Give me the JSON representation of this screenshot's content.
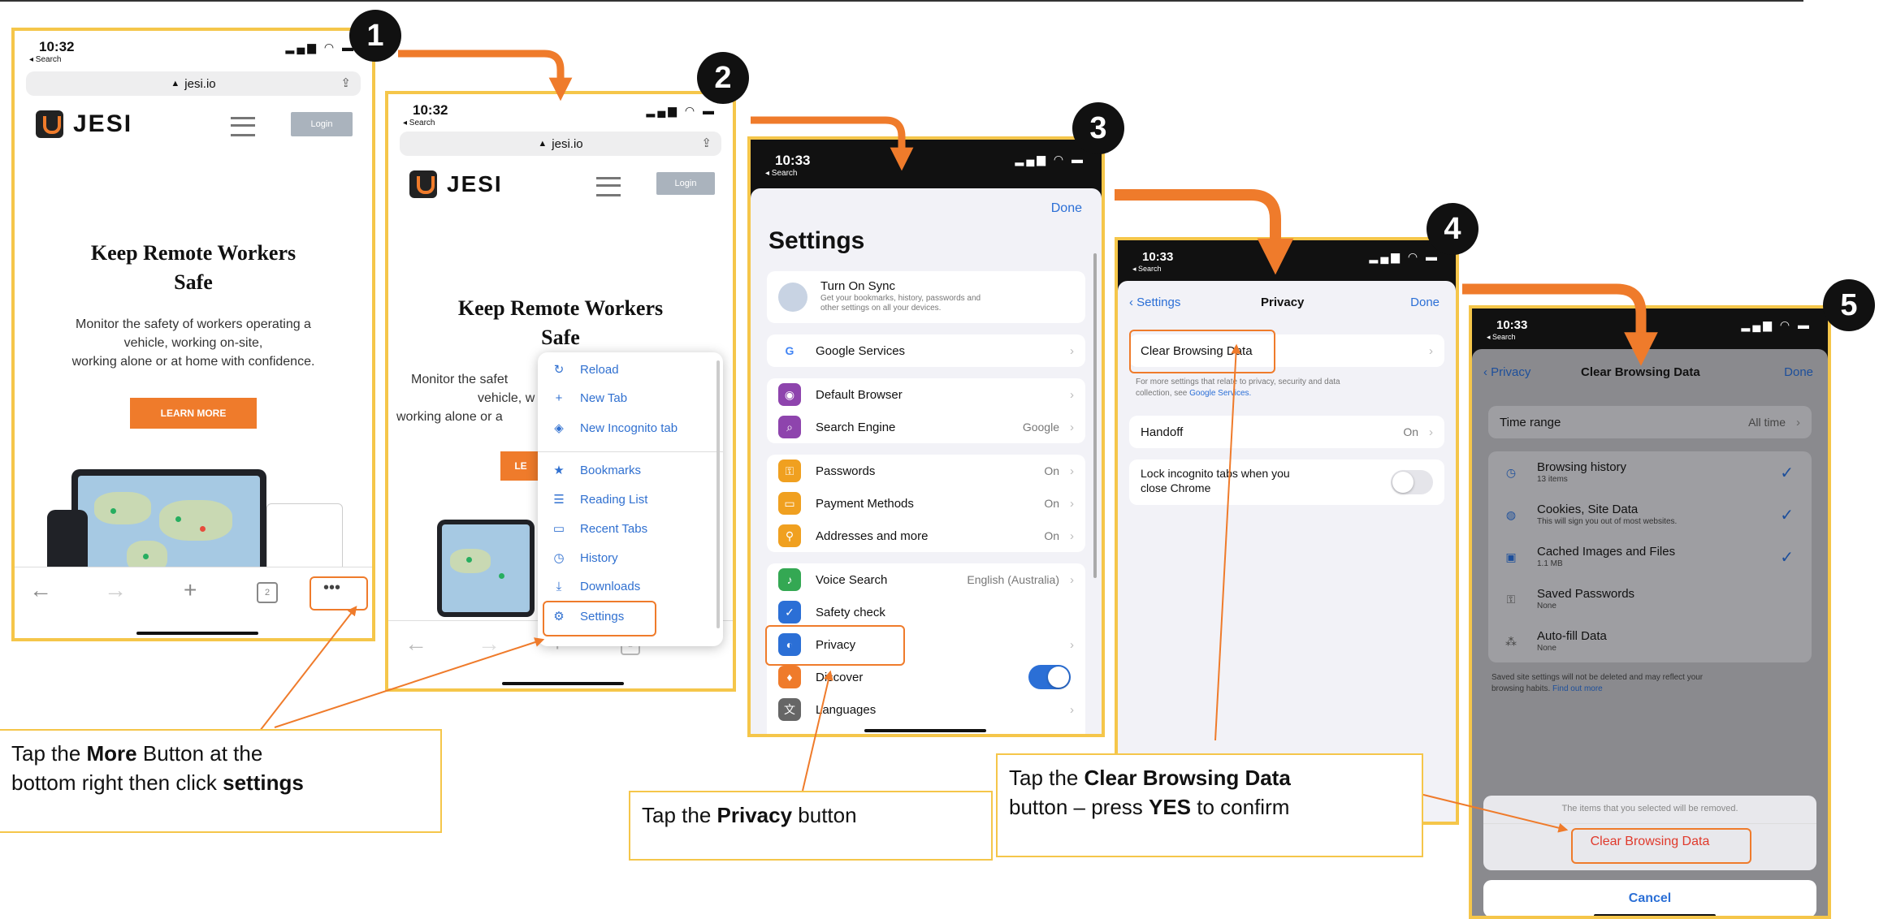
{
  "colors": {
    "accent": "#ef7b2b",
    "frame": "#f5c64a",
    "ios_blue": "#2b6fd6"
  },
  "steps": [
    "1",
    "2",
    "3",
    "4",
    "5"
  ],
  "phone1": {
    "time": "10:32",
    "back": "◂ Search",
    "url": "jesi.io",
    "brand": "JESI",
    "login": "Login",
    "headline_l1": "Keep Remote Workers",
    "headline_l2": "Safe",
    "sub_l1": "Monitor the safety of workers operating a",
    "sub_l2": "vehicle, working on-site,",
    "sub_l3": "working alone or at home with confidence.",
    "learn_more": "LEARN MORE",
    "tabs_count": "2",
    "more": "•••"
  },
  "phone2": {
    "time": "10:32",
    "back": "◂ Search",
    "url": "jesi.io",
    "brand": "JESI",
    "login": "Login",
    "headline_l1": "Keep Remote Workers",
    "headline_l2": "Safe",
    "sub_l1": "Monitor the safet",
    "sub_l2": "vehicle, w",
    "sub_l3": "working alone or a",
    "learn_partial": "LE",
    "menu": [
      {
        "label": "Reload",
        "icon": "reload-icon",
        "glyph": "↻"
      },
      {
        "label": "New Tab",
        "icon": "plus-icon",
        "glyph": "+"
      },
      {
        "label": "New Incognito tab",
        "icon": "incognito-icon",
        "glyph": "◈"
      },
      {
        "label": "Bookmarks",
        "icon": "star-icon",
        "glyph": "★"
      },
      {
        "label": "Reading List",
        "icon": "list-icon",
        "glyph": "☰"
      },
      {
        "label": "Recent Tabs",
        "icon": "tabs-icon",
        "glyph": "▭"
      },
      {
        "label": "History",
        "icon": "history-icon",
        "glyph": "◷"
      },
      {
        "label": "Downloads",
        "icon": "download-icon",
        "glyph": "⤓"
      },
      {
        "label": "Settings",
        "icon": "gear-icon",
        "glyph": "⚙"
      }
    ],
    "tabs_count": "2"
  },
  "phone3": {
    "time": "10:33",
    "back": "◂ Search",
    "done": "Done",
    "title": "Settings",
    "sync_title": "Turn On Sync",
    "sync_sub1": "Get your bookmarks, history, passwords and",
    "sync_sub2": "other settings on all your devices.",
    "rows": [
      {
        "label": "Google Services",
        "value": "",
        "color": "#ffffff",
        "glyph": "G"
      },
      {
        "label": "Default Browser",
        "value": "",
        "color": "#8e44ad",
        "glyph": "◉"
      },
      {
        "label": "Search Engine",
        "value": "Google",
        "color": "#8e44ad",
        "glyph": "⌕"
      },
      {
        "label": "Passwords",
        "value": "On",
        "color": "#f0a020",
        "glyph": "⚿"
      },
      {
        "label": "Payment Methods",
        "value": "On",
        "color": "#f0a020",
        "glyph": "▭"
      },
      {
        "label": "Addresses and more",
        "value": "On",
        "color": "#f0a020",
        "glyph": "⚲"
      },
      {
        "label": "Voice Search",
        "value": "English (Australia)",
        "color": "#34a853",
        "glyph": "♪"
      },
      {
        "label": "Safety check",
        "value": "",
        "color": "#2b6fd6",
        "glyph": "✓"
      },
      {
        "label": "Privacy",
        "value": "",
        "color": "#2b6fd6",
        "glyph": "◐"
      },
      {
        "label": "Discover",
        "value": "",
        "color": "#ef7b2b",
        "glyph": "♦"
      },
      {
        "label": "Languages",
        "value": "",
        "color": "#666666",
        "glyph": "文"
      }
    ]
  },
  "phone4": {
    "time": "10:33",
    "back": "◂ Search",
    "nav_back": "Settings",
    "title": "Privacy",
    "done": "Done",
    "clear": "Clear Browsing Data",
    "note1": "For more settings that relate to privacy, security and data",
    "note2_pre": "collection, see ",
    "note2_link": "Google Services.",
    "handoff": "Handoff",
    "handoff_val": "On",
    "lock_l1": "Lock incognito tabs when you",
    "lock_l2": "close Chrome"
  },
  "phone5": {
    "time": "10:33",
    "back": "◂ Search",
    "nav_back": "Privacy",
    "title": "Clear Browsing Data",
    "done": "Done",
    "time_range": "Time range",
    "time_range_val": "All time",
    "items": [
      {
        "label": "Browsing history",
        "sub": "13 items",
        "checked": "✓",
        "icon": "history-icon",
        "glyph": "◷"
      },
      {
        "label": "Cookies, Site Data",
        "sub": "This will sign you out of most websites.",
        "checked": "✓",
        "icon": "cookie-icon",
        "glyph": "◍"
      },
      {
        "label": "Cached Images and Files",
        "sub": "1.1 MB",
        "checked": "✓",
        "icon": "image-icon",
        "glyph": "▣"
      },
      {
        "label": "Saved Passwords",
        "sub": "None",
        "checked": "",
        "icon": "key-icon",
        "glyph": "⚿"
      },
      {
        "label": "Auto-fill Data",
        "sub": "None",
        "checked": "",
        "icon": "wand-icon",
        "glyph": "⁂"
      }
    ],
    "footer1": "Saved site settings will not be deleted and may reflect your",
    "footer2_pre": "browsing habits. ",
    "footer2_link": "Find out more",
    "confirm_note": "The items that you selected will be removed.",
    "confirm_btn": "Clear Browsing Data",
    "cancel": "Cancel"
  },
  "callouts": {
    "c1_l1_pre": "Tap the ",
    "c1_l1_bold": "More",
    "c1_l1_post": " Button at the",
    "c1_l2_pre": "bottom right then click ",
    "c1_l2_bold": "settings",
    "c2_pre": "Tap the ",
    "c2_bold": "Privacy",
    "c2_post": " button",
    "c3_l1_pre": "Tap the ",
    "c3_l1_bold": "Clear Browsing Data",
    "c3_l2_pre": "button – press ",
    "c3_l2_bold": "YES",
    "c3_l2_post": " to confirm"
  }
}
